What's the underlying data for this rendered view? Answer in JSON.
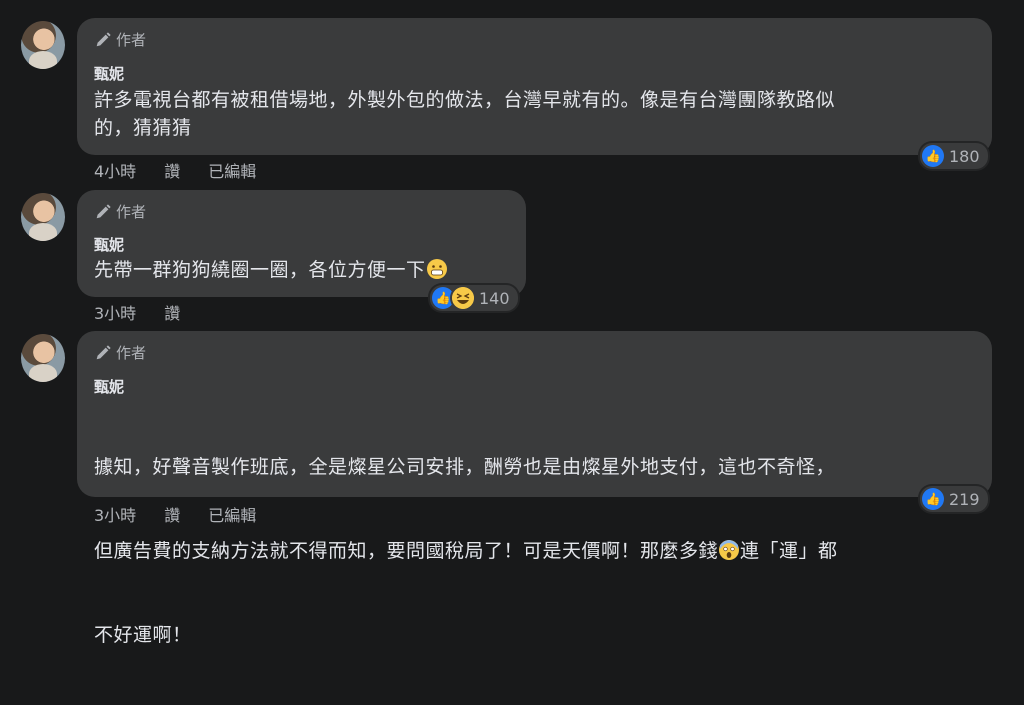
{
  "comments": [
    {
      "badge": "作者",
      "name": "甄妮",
      "text": "許多電視台都有被租借場地，外製外包的做法，台灣早就有的。像是有台灣團隊教路似\n的，猜猜猜",
      "time": "4小時",
      "reply": "讚",
      "edited": "已編輯",
      "reaction_count": "180",
      "reactions": [
        "like-icon"
      ]
    },
    {
      "badge": "作者",
      "name": "甄妮",
      "text": "先帶一群狗狗繞圈一圈，各位方便一下",
      "emoji": "grinning-emoji",
      "time": "3小時",
      "reply": "讚",
      "reaction_count": "140",
      "reactions": [
        "like-icon",
        "haha-icon"
      ]
    },
    {
      "badge": "作者",
      "name": "甄妮",
      "text_line1": "據知，好聲音製作班底，全是燦星公司安排，酬勞也是由燦星外地支付，這也不奇怪，",
      "text_line2a": "但廣告費的支納方法就不得而知，要問國稅局了！可是天價啊！那麼多錢",
      "emoji": "scream-emoji",
      "text_line2b": "連「運」都",
      "text_line3": "不好運啊！",
      "time": "3小時",
      "reply": "讚",
      "edited": "已編輯",
      "reaction_count": "219",
      "reactions": [
        "like-icon"
      ]
    }
  ],
  "colors": {
    "background": "#18191a",
    "bubble": "#3a3b3c",
    "secondary_text": "#b0b3b8",
    "like_blue": "#2078f4"
  }
}
